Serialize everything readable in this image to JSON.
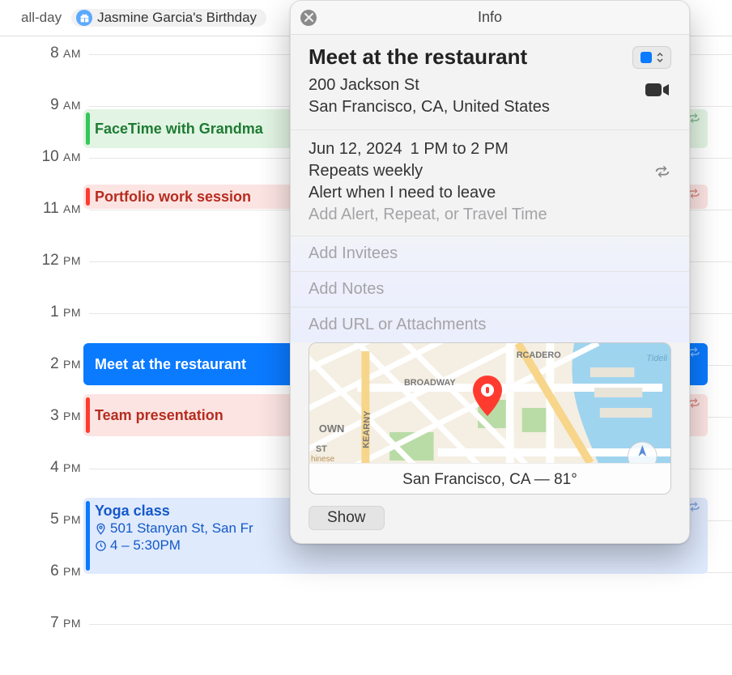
{
  "allday": {
    "label": "all-day",
    "event": "Jasmine Garcia's Birthday"
  },
  "hours": [
    "8 AM",
    "9 AM",
    "10 AM",
    "11 AM",
    "12 PM",
    "1 PM",
    "2 PM",
    "3 PM",
    "4 PM",
    "5 PM",
    "6 PM",
    "7 PM"
  ],
  "events": {
    "facetime": "FaceTime with Grandma",
    "portfolio": "Portfolio work session",
    "meet": "Meet at the restaurant",
    "team": "Team presentation",
    "yoga_title": "Yoga class",
    "yoga_loc": "501 Stanyan St, San Fr",
    "yoga_time": "4 – 5:30PM"
  },
  "popover": {
    "header": "Info",
    "title": "Meet at the restaurant",
    "loc_line1": "200 Jackson St",
    "loc_line2": "San Francisco, CA, United States",
    "date": "Jun 12, 2024",
    "time": "1 PM to 2 PM",
    "repeats": "Repeats weekly",
    "alert": "Alert when I need to leave",
    "add_alert_ph": "Add Alert, Repeat, or Travel Time",
    "add_invitees": "Add Invitees",
    "add_notes": "Add Notes",
    "add_url": "Add URL or Attachments",
    "map_weather": "San Francisco, CA — 81°",
    "map_labels": {
      "broadway": "BROADWAY",
      "ercadero": "RCADERO",
      "kearny": "KEARNY",
      "own": "OWN",
      "st": "ST",
      "tideli": "Tideli",
      "chinese": "hinese"
    },
    "show": "Show"
  }
}
